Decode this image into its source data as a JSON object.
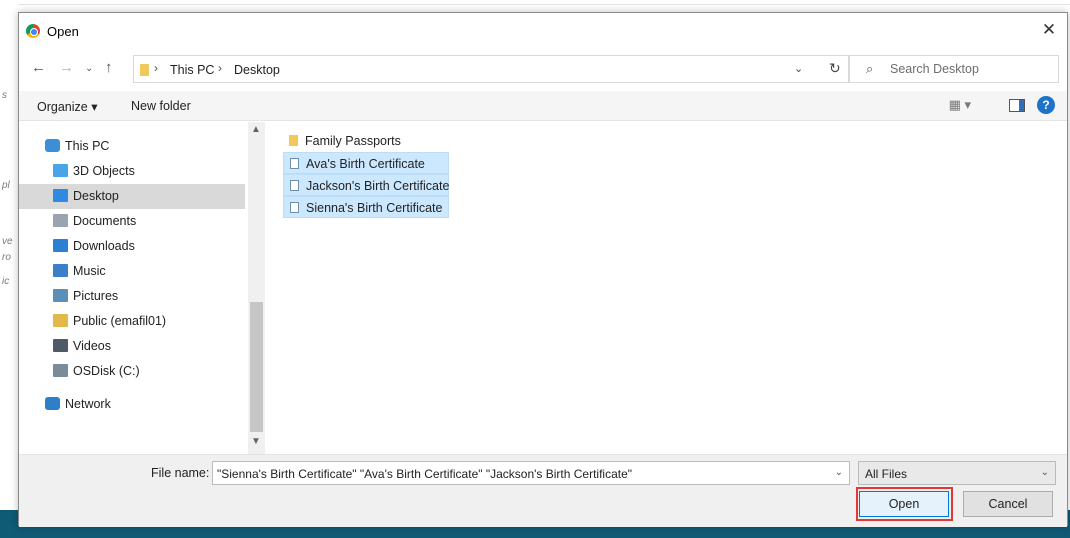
{
  "dialog": {
    "title": "Open",
    "close_symbol": "✕"
  },
  "address_bar": {
    "crumbs": [
      "This PC",
      "Desktop"
    ],
    "separator": "›"
  },
  "search": {
    "placeholder": "Search Desktop"
  },
  "toolbar": {
    "organize_label": "Organize ▾",
    "new_folder_label": "New folder"
  },
  "nav_pane": {
    "items": [
      {
        "label": "This PC",
        "icon": "pc-icon",
        "color": "#3c8fd6"
      },
      {
        "label": "3D Objects",
        "icon": "cube-icon",
        "color": "#4aa5e8"
      },
      {
        "label": "Desktop",
        "icon": "desktop-icon",
        "color": "#2d8ae0",
        "selected": true
      },
      {
        "label": "Documents",
        "icon": "document-icon",
        "color": "#9aa4b0"
      },
      {
        "label": "Downloads",
        "icon": "download-arrow-icon",
        "color": "#2d7fd1"
      },
      {
        "label": "Music",
        "icon": "music-note-icon",
        "color": "#3c7fc9"
      },
      {
        "label": "Pictures",
        "icon": "pictures-icon",
        "color": "#5b8fb8"
      },
      {
        "label": "Public (emafil01)",
        "icon": "user-folder-icon",
        "color": "#e2b84a"
      },
      {
        "label": "Videos",
        "icon": "videos-icon",
        "color": "#505a66"
      },
      {
        "label": "OSDisk (C:)",
        "icon": "drive-icon",
        "color": "#7a8c9a"
      },
      {
        "label": "Network",
        "icon": "network-icon",
        "color": "#2f7ec9"
      }
    ]
  },
  "files": [
    {
      "label": "Family Passports",
      "type": "folder",
      "selected": false
    },
    {
      "label": "Ava's Birth Certificate",
      "type": "document",
      "selected": true
    },
    {
      "label": "Jackson's Birth Certificate",
      "type": "document",
      "selected": true
    },
    {
      "label": "Sienna's Birth Certificate",
      "type": "document",
      "selected": true
    }
  ],
  "footer": {
    "file_name_label": "File name:",
    "file_name_value": "\"Sienna's Birth Certificate\" \"Ava's Birth Certificate\" \"Jackson's Birth Certificate\"",
    "file_type_value": "All Files",
    "open_label": "Open",
    "cancel_label": "Cancel"
  },
  "colors": {
    "selection_bg": "#cce8ff",
    "accent": "#0078d7",
    "highlight_box": "#e5373a"
  }
}
